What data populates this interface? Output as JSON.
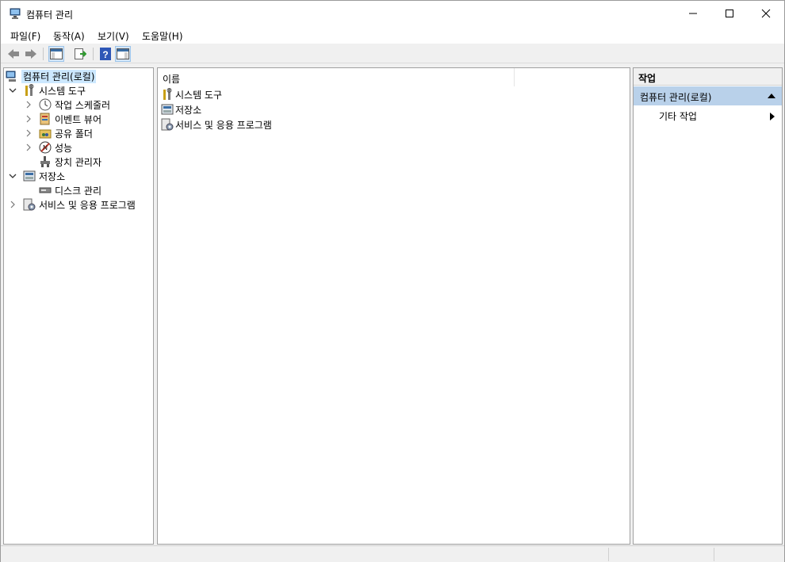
{
  "window": {
    "title": "컴퓨터 관리",
    "controls": [
      "minimize",
      "maximize",
      "close"
    ]
  },
  "menu": [
    {
      "label": "파일(F)"
    },
    {
      "label": "동작(A)"
    },
    {
      "label": "보기(V)"
    },
    {
      "label": "도움말(H)"
    }
  ],
  "toolbar": [
    "back-icon",
    "forward-icon",
    "show-hide-console-tree-icon",
    "export-list-icon",
    "help-icon",
    "show-hide-action-pane-icon"
  ],
  "tree": {
    "root": "컴퓨터 관리(로컬)",
    "system_tools": "시스템 도구",
    "task_scheduler": "작업 스케줄러",
    "event_viewer": "이벤트 뷰어",
    "shared_folders": "공유 폴더",
    "performance": "성능",
    "device_manager": "장치 관리자",
    "storage": "저장소",
    "disk_management": "디스크 관리",
    "services_apps": "서비스 및 응용 프로그램"
  },
  "center": {
    "column_name": "이름",
    "items": [
      "시스템 도구",
      "저장소",
      "서비스 및 응용 프로그램"
    ]
  },
  "actions": {
    "header": "작업",
    "section": "컴퓨터 관리(로컬)",
    "more": "기타 작업"
  },
  "colors": {
    "selection": "#cce8ff",
    "action_section": "#b9d1ea"
  }
}
